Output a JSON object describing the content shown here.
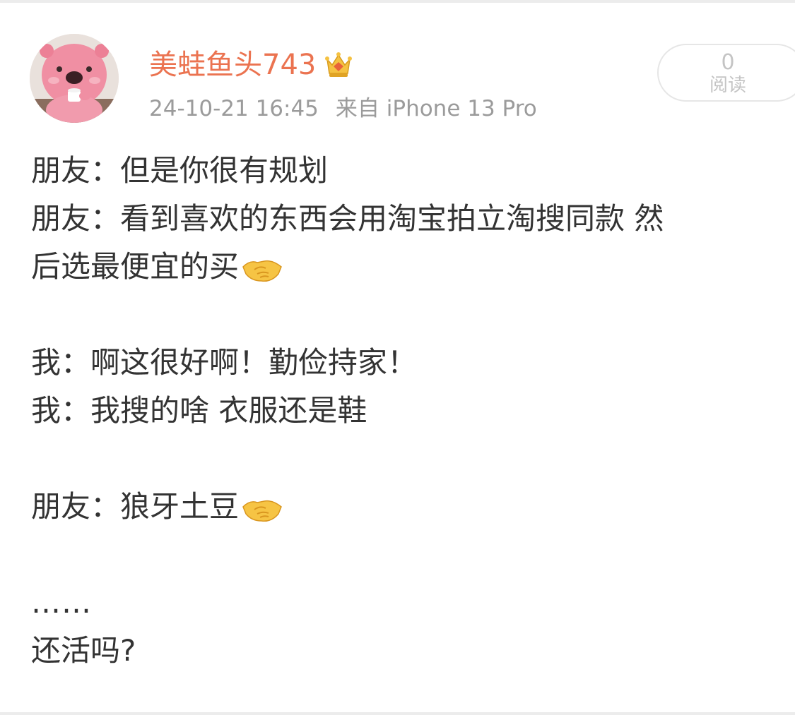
{
  "post": {
    "username": "美蛙鱼头743",
    "timestamp": "24-10-21 16:45",
    "source": "来自 iPhone 13 Pro",
    "read_count": "0",
    "read_label": "阅读",
    "lines": [
      "朋友：但是你很有规划",
      "朋友：看到喜欢的东西会用淘宝拍立淘搜同款 然",
      "后选最便宜的买",
      "我：啊这很好啊！勤俭持家！",
      "我：我搜的啥 衣服还是鞋",
      "朋友：狼牙土豆",
      "……",
      "还活吗?"
    ]
  },
  "icons": {
    "crown": "crown-badge-icon",
    "handshake": "handshake-emoji-icon"
  },
  "colors": {
    "username": "#eb7350",
    "meta": "#9b9b9b",
    "body_text": "#333333",
    "pill_border": "#e6e6e6"
  }
}
